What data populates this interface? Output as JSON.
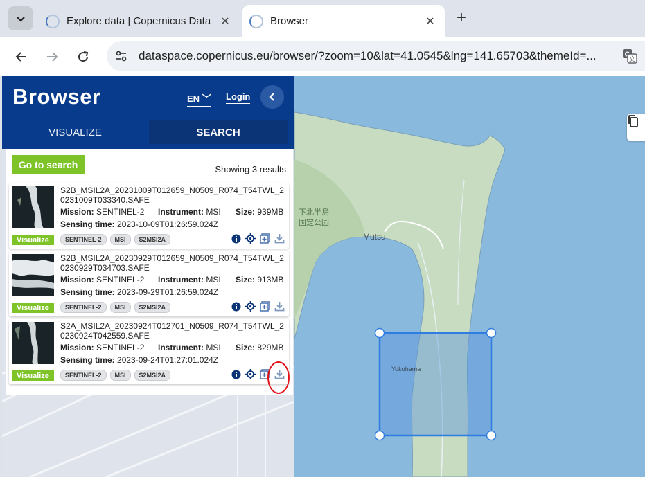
{
  "browser": {
    "tabs": [
      {
        "title": "Explore data | Copernicus Data",
        "active": false
      },
      {
        "title": "Browser",
        "active": true
      }
    ],
    "url": "dataspace.copernicus.eu/browser/?zoom=10&lat=41.0545&lng=141.65703&themeId=..."
  },
  "app": {
    "brand": "Browser",
    "language": "EN",
    "login_label": "Login",
    "tabs": {
      "visualize": "VISUALIZE",
      "search": "SEARCH"
    },
    "go_to_search_label": "Go to search",
    "results_count_text": "Showing 3 results"
  },
  "results": [
    {
      "filename": "S2B_MSIL2A_20231009T012659_N0509_R074_T54TWL_20231009T033340.SAFE",
      "mission_label": "Mission:",
      "mission": "SENTINEL-2",
      "instrument_label": "Instrument:",
      "instrument": "MSI",
      "size_label": "Size:",
      "size": "939MB",
      "sensing_label": "Sensing time:",
      "sensing_time": "2023-10-09T01:26:59.024Z",
      "visualize_label": "Visualize",
      "tags": [
        "SENTINEL-2",
        "MSI",
        "S2MSI2A"
      ]
    },
    {
      "filename": "S2B_MSIL2A_20230929T012659_N0509_R074_T54TWL_20230929T034703.SAFE",
      "mission_label": "Mission:",
      "mission": "SENTINEL-2",
      "instrument_label": "Instrument:",
      "instrument": "MSI",
      "size_label": "Size:",
      "size": "913MB",
      "sensing_label": "Sensing time:",
      "sensing_time": "2023-09-29T01:26:59.024Z",
      "visualize_label": "Visualize",
      "tags": [
        "SENTINEL-2",
        "MSI",
        "S2MSI2A"
      ]
    },
    {
      "filename": "S2A_MSIL2A_20230924T012701_N0509_R074_T54TWL_20230924T042559.SAFE",
      "mission_label": "Mission:",
      "mission": "SENTINEL-2",
      "instrument_label": "Instrument:",
      "instrument": "MSI",
      "size_label": "Size:",
      "size": "829MB",
      "sensing_label": "Sensing time:",
      "sensing_time": "2023-09-24T01:27:01.024Z",
      "visualize_label": "Visualize",
      "tags": [
        "SENTINEL-2",
        "MSI",
        "S2MSI2A"
      ]
    }
  ],
  "map": {
    "labels": {
      "park": "下北半島\n国定公园",
      "mutsu": "Mutsu",
      "yokohama": "Yokohama"
    }
  },
  "colors": {
    "header_blue": "#083b8c",
    "accent_green": "#7ec428",
    "water": "#8ab9de",
    "aoi_stroke": "#2f7de0",
    "highlight_red": "#e3141a"
  },
  "icons": [
    "tab-list-icon",
    "loading-icon",
    "close-icon",
    "new-tab-icon",
    "back-icon",
    "forward-icon",
    "reload-icon",
    "site-info-icon",
    "translate-icon",
    "chevron-left-icon",
    "info-icon",
    "locate-icon",
    "add-to-workspace-icon",
    "download-icon",
    "copy-icon"
  ]
}
